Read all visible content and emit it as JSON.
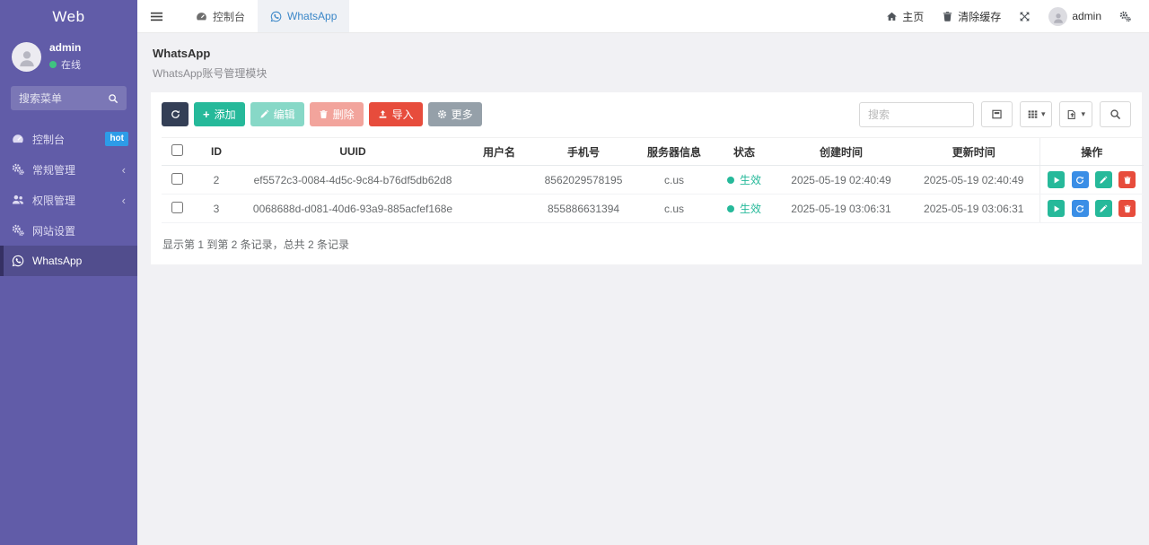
{
  "colors": {
    "sidebar_purple": "#615ca8",
    "active_item_border": "#353063",
    "hot_badge_blue": "#2d9ce8",
    "accent_blue": "#3b87c8",
    "success_green": "#26b99a",
    "danger_red": "#e74c3c",
    "dark_button": "#343f56",
    "gray_button": "#95a0a9",
    "action_refresh_blue": "#3a8ee6",
    "online_dot_green": "#3fc380"
  },
  "sidebar": {
    "brand": "Web",
    "user": {
      "name": "admin",
      "status": "在线"
    },
    "search_placeholder": "搜索菜单",
    "items": [
      {
        "label": "控制台",
        "badge": "hot"
      },
      {
        "label": "常规管理"
      },
      {
        "label": "权限管理"
      },
      {
        "label": "网站设置"
      },
      {
        "label": "WhatsApp"
      }
    ]
  },
  "topbar": {
    "tabs": [
      {
        "label": "控制台"
      },
      {
        "label": "WhatsApp"
      }
    ],
    "home": "主页",
    "clear_cache": "清除缓存",
    "user": "admin"
  },
  "page": {
    "title": "WhatsApp",
    "subtitle": "WhatsApp账号管理模块"
  },
  "toolbar": {
    "add": "添加",
    "edit": "编辑",
    "delete": "删除",
    "import": "导入",
    "more": "更多",
    "search_placeholder": "搜索"
  },
  "table": {
    "columns": [
      "ID",
      "UUID",
      "用户名",
      "手机号",
      "服务器信息",
      "状态",
      "创建时间",
      "更新时间",
      "操作"
    ],
    "rows": [
      {
        "id": "2",
        "uuid": "ef5572c3-0084-4d5c-9c84-b76df5db62d8",
        "username": "",
        "phone": "8562029578195",
        "server": "c.us",
        "status": "生效",
        "created": "2025-05-19 02:40:49",
        "updated": "2025-05-19 02:40:49"
      },
      {
        "id": "3",
        "uuid": "0068688d-d081-40d6-93a9-885acfef168e",
        "username": "",
        "phone": "855886631394",
        "server": "c.us",
        "status": "生效",
        "created": "2025-05-19 03:06:31",
        "updated": "2025-05-19 03:06:31"
      }
    ],
    "summary": "显示第 1 到第 2 条记录，总共 2 条记录"
  }
}
